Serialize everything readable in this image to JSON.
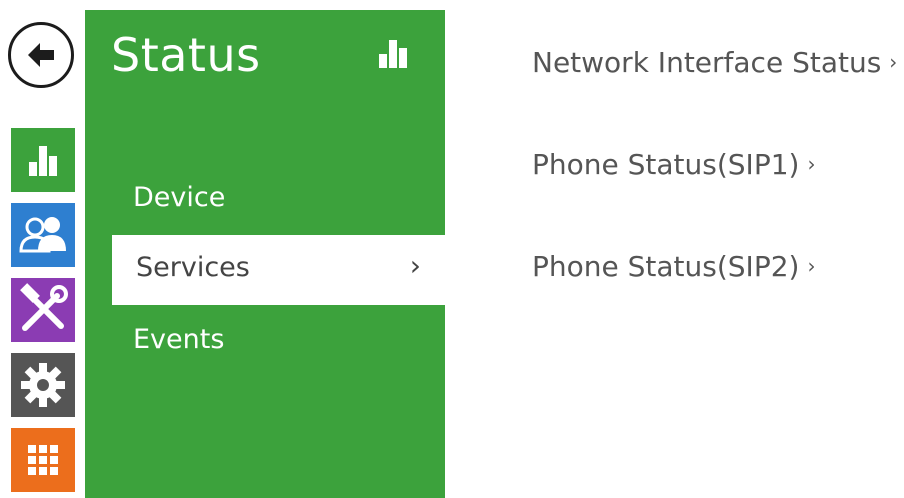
{
  "nav": {
    "back": "back-arrow-icon",
    "tiles": [
      {
        "name": "status",
        "icon": "bar-chart-icon",
        "color": "#3ca23c",
        "active": true
      },
      {
        "name": "directory",
        "icon": "users-icon",
        "color": "#2e7fd0"
      },
      {
        "name": "hardware",
        "icon": "tools-icon",
        "color": "#8b3cb3"
      },
      {
        "name": "system",
        "icon": "gear-icon",
        "color": "#555555"
      },
      {
        "name": "apps",
        "icon": "grid-icon",
        "color": "#ec6e1c"
      }
    ]
  },
  "panel": {
    "title": "Status",
    "icon": "bar-chart-icon",
    "color": "#3ca23c",
    "items": [
      {
        "label": "Device"
      },
      {
        "label": "Services",
        "active": true,
        "chevron": "›"
      },
      {
        "label": "Events"
      }
    ]
  },
  "content": {
    "links": [
      {
        "label": "Network Interface Status",
        "chevron": "›"
      },
      {
        "label": "Phone Status(SIP1)",
        "chevron": "›"
      },
      {
        "label": "Phone Status(SIP2)",
        "chevron": "›"
      }
    ]
  }
}
